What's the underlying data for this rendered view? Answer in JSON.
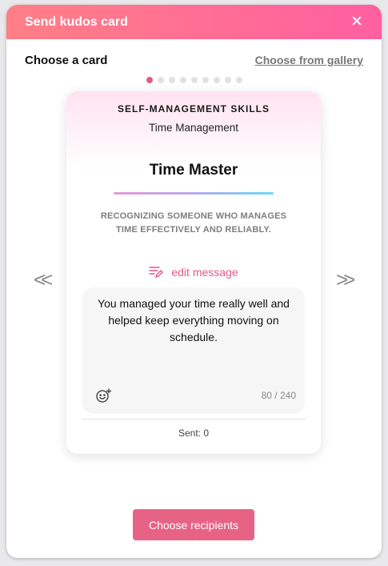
{
  "dialog": {
    "title": "Send kudos card",
    "close_icon": "close-icon"
  },
  "subhead": {
    "title": "Choose a card",
    "gallery_link": "Choose from gallery"
  },
  "carousel": {
    "total_cards": 9,
    "active_index": 0,
    "prev_label": "<<",
    "next_label": ">>"
  },
  "card": {
    "category": "SELF-MANAGEMENT SKILLS",
    "subcategory": "Time Management",
    "title": "Time Master",
    "description": "RECOGNIZING SOMEONE WHO MANAGES TIME EFFECTIVELY AND RELIABLY.",
    "edit_label": "edit message",
    "message": "You managed your time really well and helped keep everything moving on schedule.",
    "char_count": "80 / 240",
    "sent": "Sent: 0"
  },
  "footer": {
    "button_label": "Choose recipients"
  },
  "colors": {
    "header_start": "#ff7f86",
    "header_end": "#ff5fa0",
    "accent": "#e05a82",
    "button": "#e66385"
  }
}
